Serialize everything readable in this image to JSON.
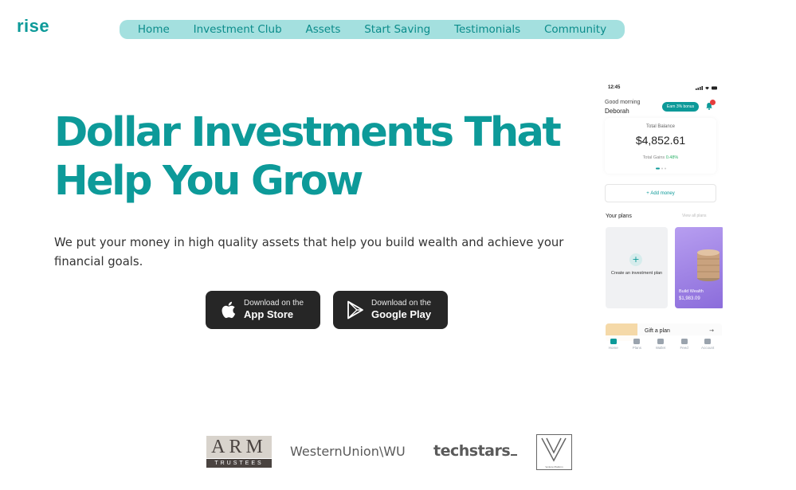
{
  "brand": {
    "logo_text": "rise",
    "accent": "#0d9a99"
  },
  "nav": {
    "items": [
      {
        "label": "Home"
      },
      {
        "label": "Investment Club"
      },
      {
        "label": "Assets"
      },
      {
        "label": "Start Saving"
      },
      {
        "label": "Testimonials"
      },
      {
        "label": "Community"
      }
    ]
  },
  "hero": {
    "title": "Dollar Investments That Help You Grow",
    "subtitle": "We put your money in high quality assets that help you build wealth and achieve your financial goals."
  },
  "downloads": {
    "app_store": {
      "small": "Download on the",
      "big": "App Store",
      "icon": "apple-icon"
    },
    "google_play": {
      "small": "Download on the",
      "big": "Google Play",
      "icon": "play-icon"
    }
  },
  "phone": {
    "time": "12:45",
    "greeting": "Good morning",
    "user_name": "Deborah",
    "earn_badge": "Earn 3% bonus",
    "notification_count": "3",
    "balance_label": "Total Balance",
    "balance_value": "$4,852.61",
    "gains_label": "Total Gains",
    "gains_value": "0.48%",
    "add_money": "Add money",
    "plans_title": "Your plans",
    "view_all": "View all plans",
    "create_plan": "Create an investment plan",
    "plan_name": "Build Wealth",
    "plan_value": "$1,983.09",
    "gift_label": "Gift a plan",
    "tabs": [
      {
        "label": "Home"
      },
      {
        "label": "Plans"
      },
      {
        "label": "Wallet"
      },
      {
        "label": "Feed"
      },
      {
        "label": "Account"
      }
    ]
  },
  "partners": {
    "arm_top": "ARM",
    "arm_bottom": "TRUSTEES",
    "western_union": "WesternUnion\\WU",
    "techstars": "techstars",
    "vlogo_caption": "Venture Platform"
  }
}
